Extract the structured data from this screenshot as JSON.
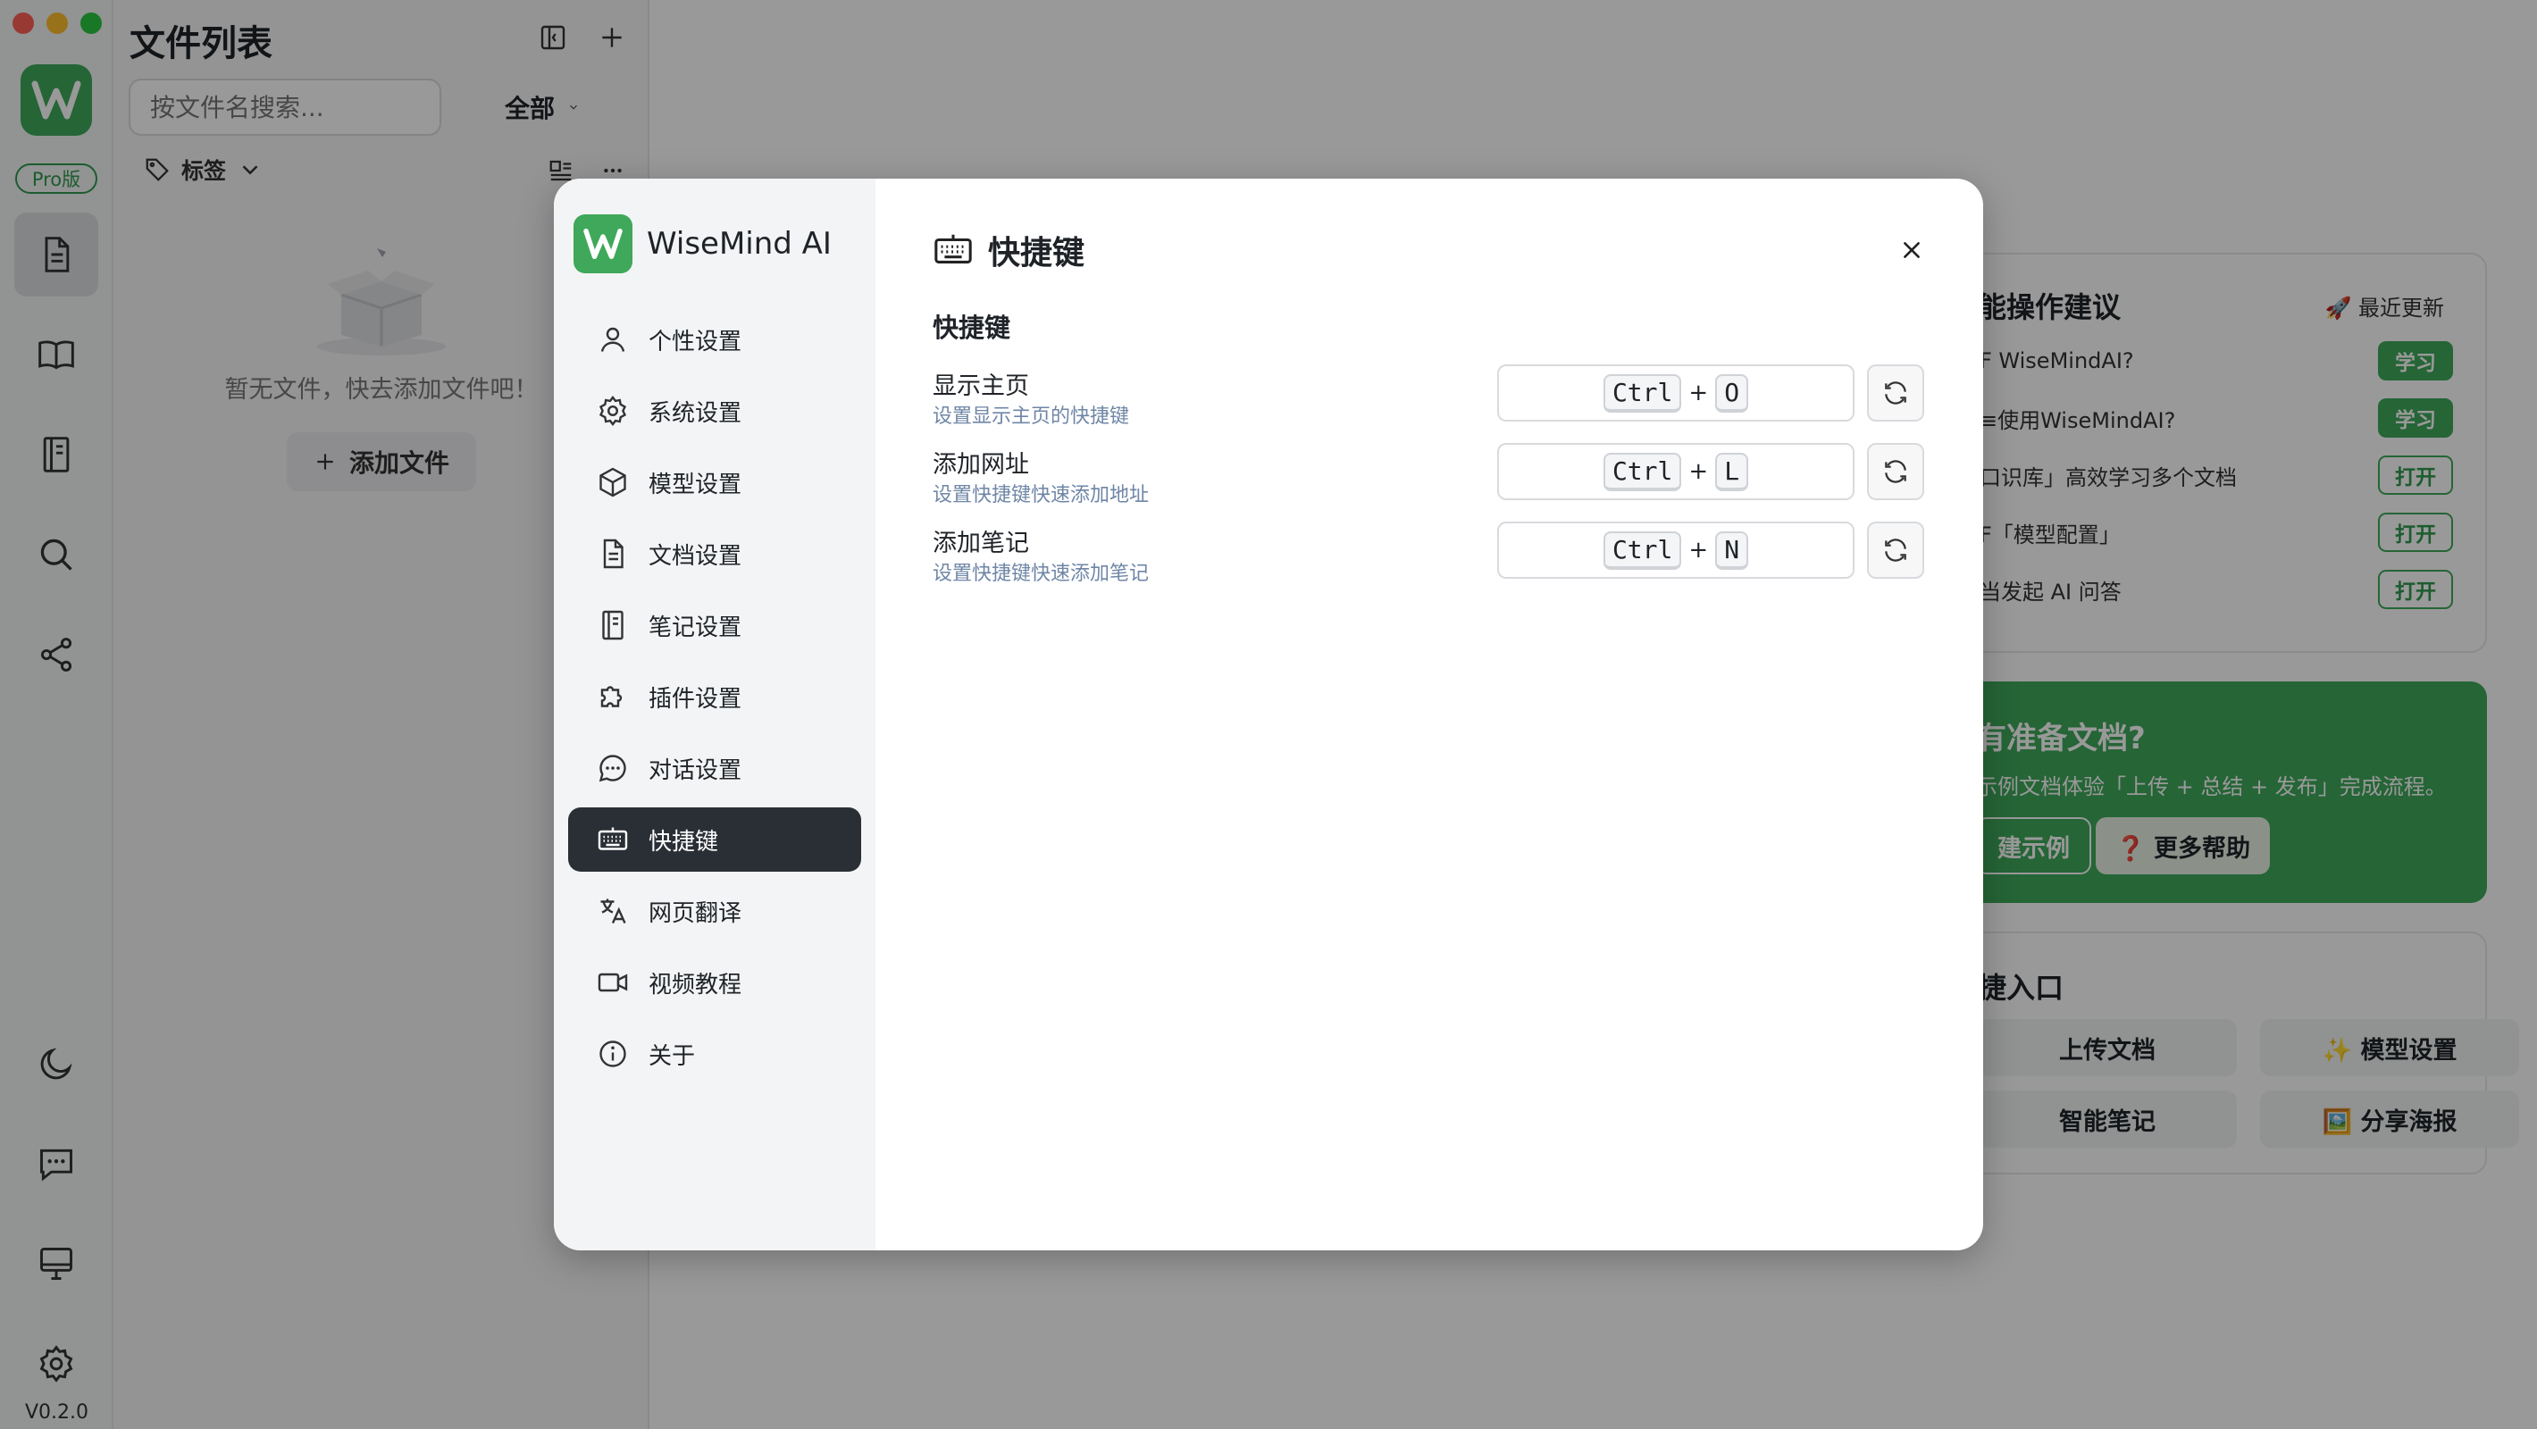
{
  "rail": {
    "pro_badge": "Pro版",
    "version": "V0.2.0"
  },
  "files": {
    "title": "文件列表",
    "search_placeholder": "按文件名搜索...",
    "filter_label": "全部",
    "tag_label": "标签",
    "empty_text": "暂无文件，快去添加文件吧！",
    "add_file_label": "添加文件"
  },
  "home": {
    "tips_title": "能操作建议",
    "recent_update": "🚀 最近更新",
    "tips": [
      {
        "text": "F WiseMindAI?",
        "button": "学习",
        "kind": "learn"
      },
      {
        "text": "≡使用WiseMindAI?",
        "button": "学习",
        "kind": "learn"
      },
      {
        "text": "口识库」高效学习多个文档",
        "button": "打开",
        "kind": "open"
      },
      {
        "text": "F「模型配置」",
        "button": "打开",
        "kind": "open"
      },
      {
        "text": "当发起 AI 问答",
        "button": "打开",
        "kind": "open"
      }
    ],
    "green_title": "有准备文档?",
    "green_desc": "示例文档体验「上传 + 总结 + 发布」完成流程。",
    "green_btn_example": "建示例",
    "green_btn_help": "❓ 更多帮助",
    "entry_title": "捷入口",
    "entries": [
      "上传文档",
      "✨ 模型设置",
      "智能笔记",
      "🖼️ 分享海报"
    ]
  },
  "modal": {
    "brand": "WiseMind AI",
    "nav": [
      {
        "label": "个性设置",
        "icon": "user-icon"
      },
      {
        "label": "系统设置",
        "icon": "gear-icon"
      },
      {
        "label": "模型设置",
        "icon": "cube-icon"
      },
      {
        "label": "文档设置",
        "icon": "document-icon"
      },
      {
        "label": "笔记设置",
        "icon": "notebook-icon"
      },
      {
        "label": "插件设置",
        "icon": "puzzle-icon"
      },
      {
        "label": "对话设置",
        "icon": "chat-icon"
      },
      {
        "label": "快捷键",
        "icon": "keyboard-icon"
      },
      {
        "label": "网页翻译",
        "icon": "translate-icon"
      },
      {
        "label": "视频教程",
        "icon": "video-icon"
      },
      {
        "label": "关于",
        "icon": "info-icon"
      }
    ],
    "active_nav": "快捷键",
    "header_title": "快捷键",
    "section_label": "快捷键",
    "shortcuts": [
      {
        "title": "显示主页",
        "desc": "设置显示主页的快捷键",
        "mod": "Ctrl",
        "plus": "+",
        "key": "O"
      },
      {
        "title": "添加网址",
        "desc": "设置快捷键快速添加地址",
        "mod": "Ctrl",
        "plus": "+",
        "key": "L"
      },
      {
        "title": "添加笔记",
        "desc": "设置快捷键快速添加笔记",
        "mod": "Ctrl",
        "plus": "+",
        "key": "N"
      }
    ]
  },
  "colors": {
    "brand_green": "#3fa85a",
    "active_nav_bg": "#2a2f36",
    "desc_blue": "#6f86a6"
  }
}
